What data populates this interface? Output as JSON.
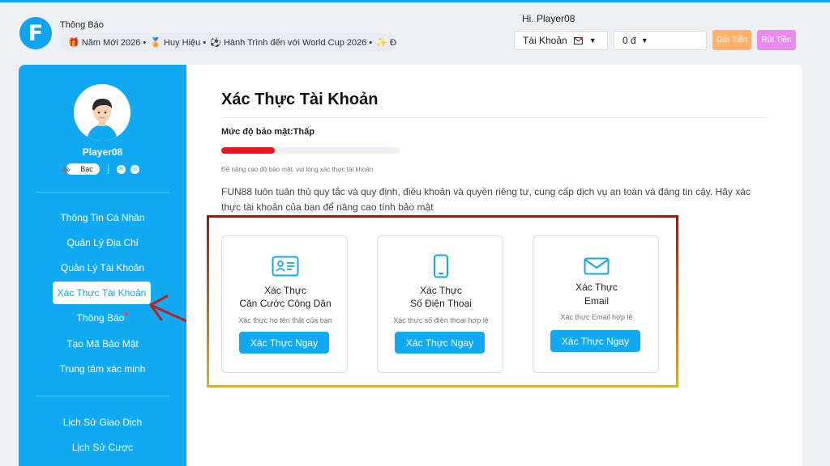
{
  "header": {
    "notice_title": "Thông Báo",
    "marquee": [
      "🎁 Năm Mới 2026 •",
      "🏅 Huy Hiệu •",
      "⚽ Hành Trình đến với World Cup 2026 •",
      "✨ Điểm"
    ],
    "greeting": "Hi. Player08",
    "account_select": "Tài Khoản",
    "balance": "0 đ",
    "deposit_label": "Gửi Tiền",
    "withdraw_label": "Rút Tiền"
  },
  "sidebar": {
    "username": "Player08",
    "level": "Bạc",
    "items": [
      {
        "label": "Thông Tin Cá Nhân"
      },
      {
        "label": "Quản Lý Địa Chỉ"
      },
      {
        "label": "Quản Lý Tài Khoản"
      },
      {
        "label": "Xác Thực Tài Khoản"
      },
      {
        "label": "Thông Báo"
      },
      {
        "label": "Tạo Mã Bảo Mật"
      },
      {
        "label": "Trung tâm xác minh"
      }
    ],
    "history": [
      {
        "label": "Lịch Sử Giao Dịch"
      },
      {
        "label": "Lịch Sử Cược"
      }
    ]
  },
  "main": {
    "title": "Xác Thực Tài Khoản",
    "security_level": "Mức độ bảo mật:Thấp",
    "security_progress": 0.3,
    "hint": "Để nâng cao độ bảo mật, vui lòng xác thực tài khoản",
    "description": "FUN88 luôn tuân thủ quy tắc và quy định, điều khoản và quyền riêng tư, cung cấp dịch vụ an toàn và đáng tin cậy. Hãy xác thực tài khoản của bạn để nâng cao tính bảo mật",
    "cards": [
      {
        "title_1": "Xác Thực",
        "title_2": "Căn Cước Công Dân",
        "subtitle": "Xác thực họ tên thật của bạn",
        "button": "Xác Thực Ngay",
        "icon": "id-card-icon"
      },
      {
        "title_1": "Xác Thực",
        "title_2": "Số Điện Thoại",
        "subtitle": "Xác thực số điện thoại hợp lệ",
        "button": "Xác Thực Ngay",
        "icon": "phone-icon"
      },
      {
        "title_1": "Xác Thực",
        "title_2": "Email",
        "subtitle": "Xác thực Email hợp lệ",
        "button": "Xác Thực Ngay",
        "icon": "mail-icon"
      }
    ]
  },
  "colors": {
    "brand": "#10a9f2",
    "danger": "#e8161f",
    "deposit": "#ffb06d",
    "withdraw": "#e98bf0"
  }
}
